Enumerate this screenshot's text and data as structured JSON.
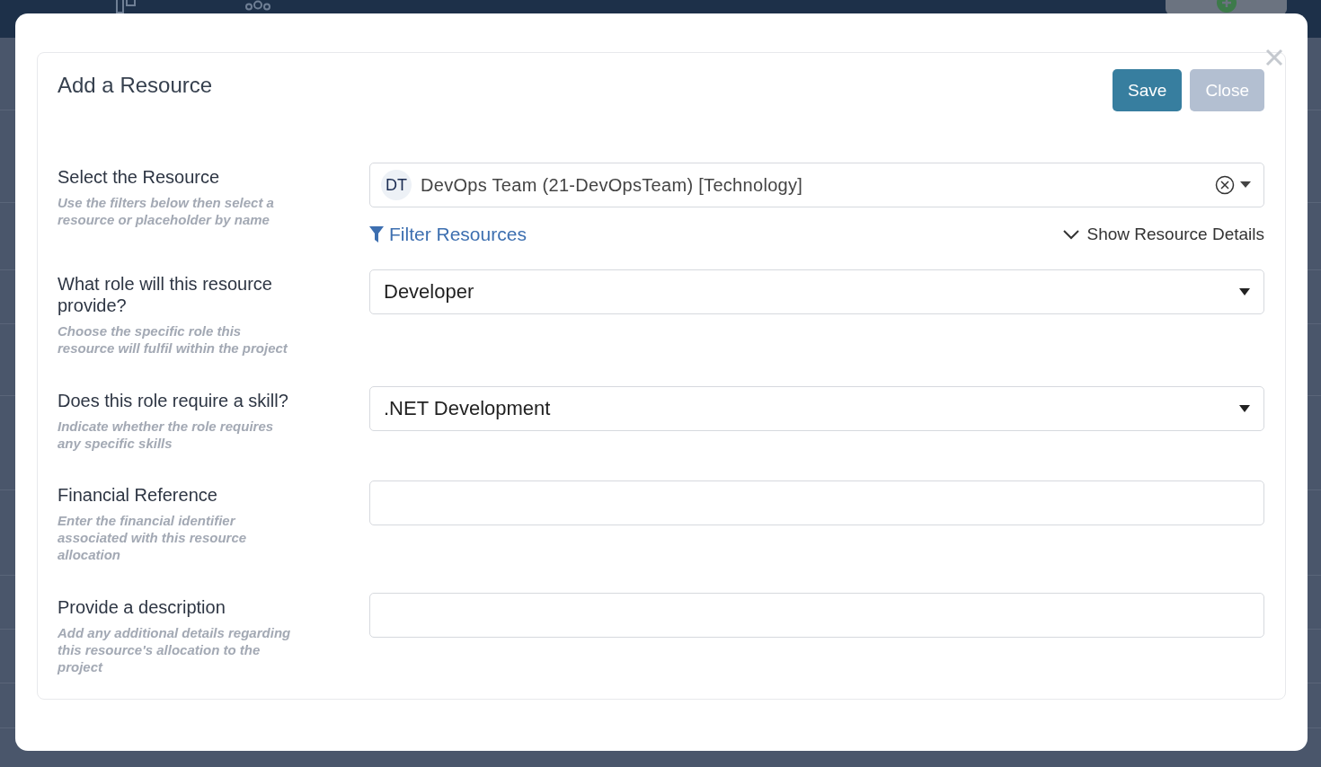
{
  "modal": {
    "title": "Add a Resource",
    "buttons": [
      {
        "label": "Save",
        "disabled": false
      },
      {
        "label": "Close",
        "disabled": true
      }
    ],
    "fields": [
      {
        "kind": "resource",
        "label": "Select the Resource",
        "hint": "Use the filters below then select a resource or placeholder by name",
        "avatar": "DT",
        "value": "DevOps Team (21-DevOpsTeam) [Technology]",
        "filter_link": "Filter Resources",
        "details_link": "Show Resource Details",
        "expanded": false
      },
      {
        "kind": "select",
        "label": "What role will this resource provide?",
        "hint": "Choose the specific role this resource will fulfil within the project",
        "value": "Developer"
      },
      {
        "kind": "select",
        "label": "Does this role require a skill?",
        "hint": "Indicate whether the role requires any specific skills",
        "value": ".NET Development"
      },
      {
        "kind": "text",
        "label": "Financial Reference",
        "hint": "Enter the financial identifier associated with this resource allocation"
      },
      {
        "kind": "text",
        "label": "Provide a description",
        "hint": "Add any additional details regarding this resource's allocation to the project"
      }
    ]
  }
}
